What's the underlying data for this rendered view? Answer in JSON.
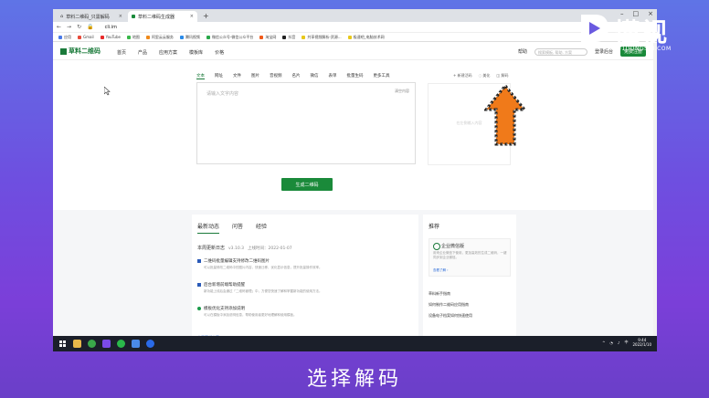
{
  "browser": {
    "tabs": [
      {
        "title": "草料二维码_只需解码"
      },
      {
        "title": "草料二维码生成器"
      }
    ],
    "url": "cli.im",
    "bookmarks": [
      "应用",
      "Gmail",
      "YouTube",
      "地图",
      "阿里云云服务",
      "腾讯视频",
      "微信公众号-微信公众平台",
      "淘宝网",
      "抖音",
      "共享视频解析-资源...",
      "极速吧_电脑技术网"
    ]
  },
  "site": {
    "logo": "草料二维码",
    "nav": [
      "首页",
      "产品",
      "应用方案",
      "模板库",
      "价格"
    ],
    "help": "帮助",
    "search_placeholder": "搜索模板, 帮助, 方案",
    "login": "登录后台",
    "free_signup": "免费注册"
  },
  "content_tabs": [
    "文本",
    "网址",
    "文件",
    "图片",
    "音视频",
    "名片",
    "微信",
    "表单",
    "批量生码",
    "更多工具"
  ],
  "editor": {
    "placeholder": "请输入文字内容",
    "clear": "清空内容"
  },
  "right_tools": [
    "新建活码",
    "美化",
    "解码"
  ],
  "preview_text": "在左侧输入内容",
  "generate_button": "生成二维码",
  "news": {
    "tabs": [
      "最新动态",
      "问答",
      "经验"
    ],
    "title": "本周更新日志",
    "version": "v3.10.3",
    "date": "上线时间：2022-01-07",
    "items": [
      {
        "title": "二维码批量编辑支持修改二维码图片",
        "desc": "可以批量修改二维码中的图片内容，快速迁移、优化显示信息，提升批量操作效率。",
        "color": "#2a5ab8"
      },
      {
        "title": "后台新增前端帮助提醒",
        "desc": "新功能上线后会通过「二维码管理」中，方便您快速了解和掌握新功能的使用方法。",
        "color": "#2a5ab8"
      },
      {
        "title": "模板优化支持添加说明",
        "desc": "可以在模板中添加说明信息，帮助使用者更好地理解和使用模板。",
        "color": "#1a9a4a"
      }
    ],
    "more": "查看更新内容 ›"
  },
  "recommend": {
    "title": "推荐",
    "card_title": "企业微信版",
    "card_desc": "用来企业微信下使用，更加高效的生成二维码，一键同步到企业微信。",
    "card_link": "查看了解 ›",
    "links": [
      "草料新手指南",
      "如何制作二维码应用指南",
      "设备电子档案如何快速使用"
    ]
  },
  "taskbar": {
    "time": "9:44",
    "date": "2022/1/10",
    "lang": "中"
  },
  "watermark": {
    "main": "懂视",
    "sub": "51DONGSHI.COM"
  },
  "caption": "选择解码",
  "colors": {
    "brand_green": "#1a8a3a",
    "highlight_arrow": "#f07a1a"
  }
}
